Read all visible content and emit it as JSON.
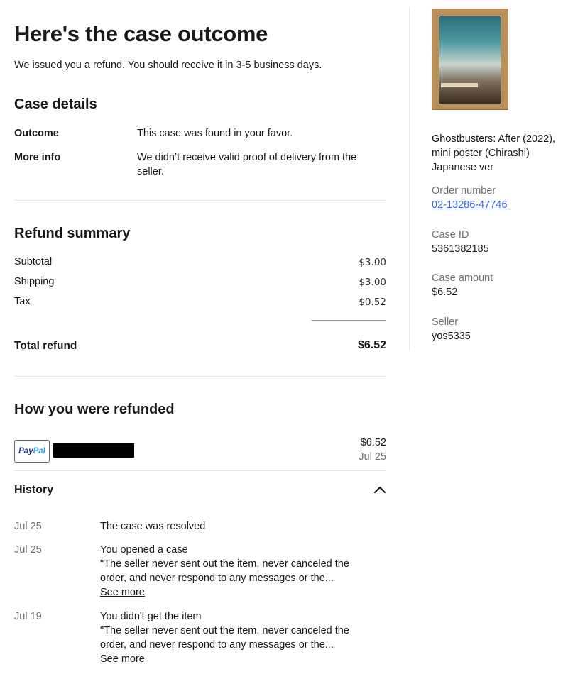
{
  "page": {
    "title": "Here's the case outcome",
    "subtitle": "We issued you a refund. You should receive it in 3-5 business days."
  },
  "case_details": {
    "heading": "Case details",
    "rows": [
      {
        "label": "Outcome",
        "value": "This case was found in your favor."
      },
      {
        "label": "More info",
        "value": "We didn’t receive valid proof of delivery from the seller."
      }
    ]
  },
  "refund_summary": {
    "heading": "Refund summary",
    "lines": [
      {
        "label": "Subtotal",
        "value": "$3.00"
      },
      {
        "label": "Shipping",
        "value": "$3.00"
      },
      {
        "label": "Tax",
        "value": "$0.52"
      }
    ],
    "total_label": "Total refund",
    "total_value": "$6.52"
  },
  "refund_method": {
    "heading": "How you were refunded",
    "provider": "PayPal",
    "provider_a": "Pay",
    "provider_b": "Pal",
    "amount": "$6.52",
    "date": "Jul 25"
  },
  "history": {
    "heading": "History",
    "entries": [
      {
        "date": "Jul 25",
        "title": "The case was resolved",
        "detail": "",
        "link": ""
      },
      {
        "date": "Jul 25",
        "title": "You opened a case",
        "detail": "\"The seller never sent out the item, never canceled the order, and never respond to any messages or the...",
        "link": "See more"
      },
      {
        "date": "Jul 19",
        "title": "You didn't get the item",
        "detail": "\"The seller never sent out the item, never canceled the order, and never respond to any messages or the...",
        "link": "See more"
      }
    ]
  },
  "sidebar": {
    "item_title": "Ghostbusters: After (2022), mini poster (Chirashi) Japanese ver",
    "order_number_label": "Order number",
    "order_number": "02-13286-47746",
    "case_id_label": "Case ID",
    "case_id": "5361382185",
    "case_amount_label": "Case amount",
    "case_amount": "$6.52",
    "seller_label": "Seller",
    "seller": "yos5335"
  },
  "colors": {
    "link": "#3665f3",
    "muted": "#707070",
    "paypal_dark": "#1f3b82",
    "paypal_light": "#2a9ee0"
  }
}
